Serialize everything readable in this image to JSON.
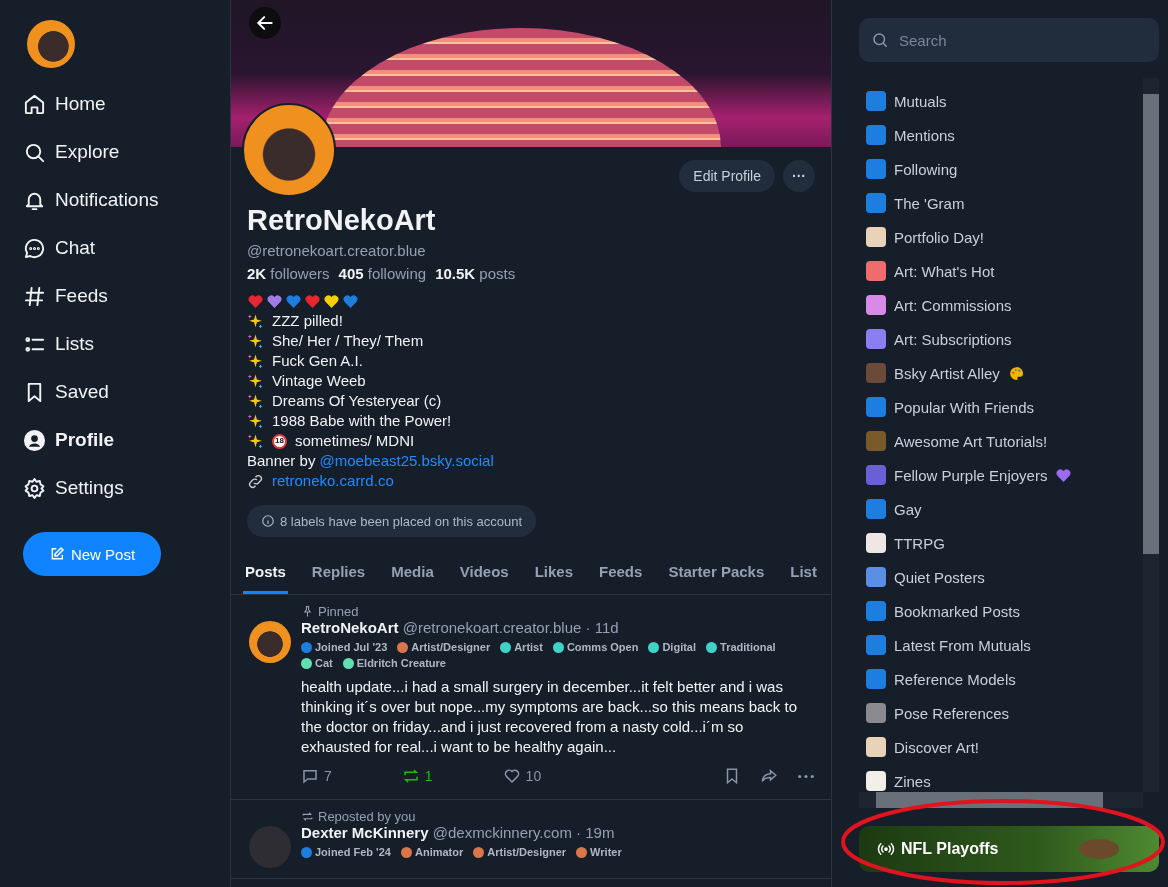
{
  "nav": {
    "items": [
      {
        "label": "Home",
        "selected": false
      },
      {
        "label": "Explore",
        "selected": false
      },
      {
        "label": "Notifications",
        "selected": false
      },
      {
        "label": "Chat",
        "selected": false
      },
      {
        "label": "Feeds",
        "selected": false
      },
      {
        "label": "Lists",
        "selected": false
      },
      {
        "label": "Saved",
        "selected": false
      },
      {
        "label": "Profile",
        "selected": true
      },
      {
        "label": "Settings",
        "selected": false
      }
    ],
    "new_post": "New Post"
  },
  "profile": {
    "edit_button": "Edit Profile",
    "more_button": "···",
    "name": "RetroNekoArt",
    "handle": "@retronekoart.creator.blue",
    "stats": [
      {
        "count": "2K",
        "label": "followers"
      },
      {
        "count": "405",
        "label": "following"
      },
      {
        "count": "10.5K",
        "label": "posts"
      }
    ],
    "hearts": [
      {
        "color": "#e8262f"
      },
      {
        "color": "#a07ce6"
      },
      {
        "color": "#1d7ee0"
      },
      {
        "color": "#e8262f"
      },
      {
        "color": "#f5cf0a"
      },
      {
        "color": "#1d7ee0"
      }
    ],
    "bio": [
      {
        "kind": "sparkle",
        "text": "ZZZ pilled!"
      },
      {
        "kind": "sparkle",
        "text": "She/ Her / They/ Them"
      },
      {
        "kind": "sparkle",
        "text": "Fuck Gen A.I."
      },
      {
        "kind": "sparkle",
        "text": "Vintage Weeb"
      },
      {
        "kind": "sparkle",
        "text": "Dreams Of Yesteryear (c)"
      },
      {
        "kind": "sparkle",
        "text": "1988 Babe with the Power!"
      },
      {
        "kind": "sparkle_18",
        "badge": "18",
        "text": "sometimes/ MDNI"
      }
    ],
    "banner_credit": {
      "text": "Banner by ",
      "link": "@moebeast25.bsky.social"
    },
    "website": "retroneko.carrd.co",
    "labels_notice": "8 labels have been placed on this account"
  },
  "tabs": [
    {
      "label": "Posts",
      "selected": true
    },
    {
      "label": "Replies",
      "selected": false
    },
    {
      "label": "Media",
      "selected": false
    },
    {
      "label": "Videos",
      "selected": false
    },
    {
      "label": "Likes",
      "selected": false
    },
    {
      "label": "Feeds",
      "selected": false
    },
    {
      "label": "Starter Packs",
      "selected": false
    },
    {
      "label": "List",
      "selected": false
    }
  ],
  "posts": [
    {
      "kind": "pinned",
      "context": "Pinned",
      "name": "RetroNekoArt",
      "handle": "@retronekoart.creator.blue",
      "time": "· 11d",
      "badges": [
        {
          "label": "Joined Jul '23",
          "color": "#1d7ee0"
        },
        {
          "label": "Artist/Designer",
          "color": "#d9764a"
        },
        {
          "label": "Artist",
          "color": "#3fd2c7"
        },
        {
          "label": "Comms Open",
          "color": "#3fd2c7"
        },
        {
          "label": "Digital",
          "color": "#3fd2c7"
        },
        {
          "label": "Traditional",
          "color": "#3fd2c7"
        },
        {
          "label": "Cat",
          "color": "#5fe0b0"
        },
        {
          "label": "Eldritch Creature",
          "color": "#5fe0b0"
        }
      ],
      "text": "health update...i had a small surgery in december...it felt better and i was thinking it´s over but nope...my symptoms are back...so this means back to the doctor on friday...and i just recovered from a nasty cold...i´m so exhausted for real...i want to be healthy again...",
      "replies": "7",
      "reposts": "1",
      "reposted": true,
      "likes": "10",
      "liked": false
    },
    {
      "kind": "repost",
      "context": "Reposted by you",
      "name": "Dexter McKinnery",
      "handle": "@dexmckinnery.com",
      "time": "· 19m",
      "badges": [
        {
          "label": "Joined Feb '24",
          "color": "#1d7ee0"
        },
        {
          "label": "Animator",
          "color": "#d9764a"
        },
        {
          "label": "Artist/Designer",
          "color": "#d9764a"
        },
        {
          "label": "Writer",
          "color": "#d9764a"
        }
      ]
    }
  ],
  "search": {
    "placeholder": "Search"
  },
  "feeds": [
    {
      "label": "Mutuals",
      "color": "#1d7ee0"
    },
    {
      "label": "Mentions",
      "color": "#1d7ee0"
    },
    {
      "label": "Following",
      "color": "#1d7ee0"
    },
    {
      "label": "The 'Gram",
      "color": "#1d7ee0"
    },
    {
      "label": "Portfolio Day!",
      "color": "#e9d3b8"
    },
    {
      "label": "Art: What's Hot",
      "color": "#f06b6b"
    },
    {
      "label": "Art: Commissions",
      "color": "#d88ae6"
    },
    {
      "label": "Art: Subscriptions",
      "color": "#8b7ef0"
    },
    {
      "label": "Bsky Artist Alley",
      "color": "#6b4a3a",
      "kind": "palette"
    },
    {
      "label": "Popular With Friends",
      "color": "#1d7ee0"
    },
    {
      "label": "Awesome Art Tutorials!",
      "color": "#7a5a2a"
    },
    {
      "label": "Fellow Purple Enjoyers",
      "color": "#6b5fd6",
      "kind": "heart"
    },
    {
      "label": "Gay",
      "color": "#1d7ee0"
    },
    {
      "label": "TTRPG",
      "color": "#f0e6e6"
    },
    {
      "label": "Quiet Posters",
      "color": "#5b8fe6"
    },
    {
      "label": "Bookmarked Posts",
      "color": "#1d7ee0"
    },
    {
      "label": "Latest From Mutuals",
      "color": "#1d7ee0"
    },
    {
      "label": "Reference Models",
      "color": "#1d7ee0"
    },
    {
      "label": "Pose References",
      "color": "#8a8a90"
    },
    {
      "label": "Discover Art!",
      "color": "#e9d3b8"
    },
    {
      "label": "Zines",
      "color": "#f2efe8"
    }
  ],
  "trending": {
    "label": "NFL Playoffs",
    "circled": true
  }
}
